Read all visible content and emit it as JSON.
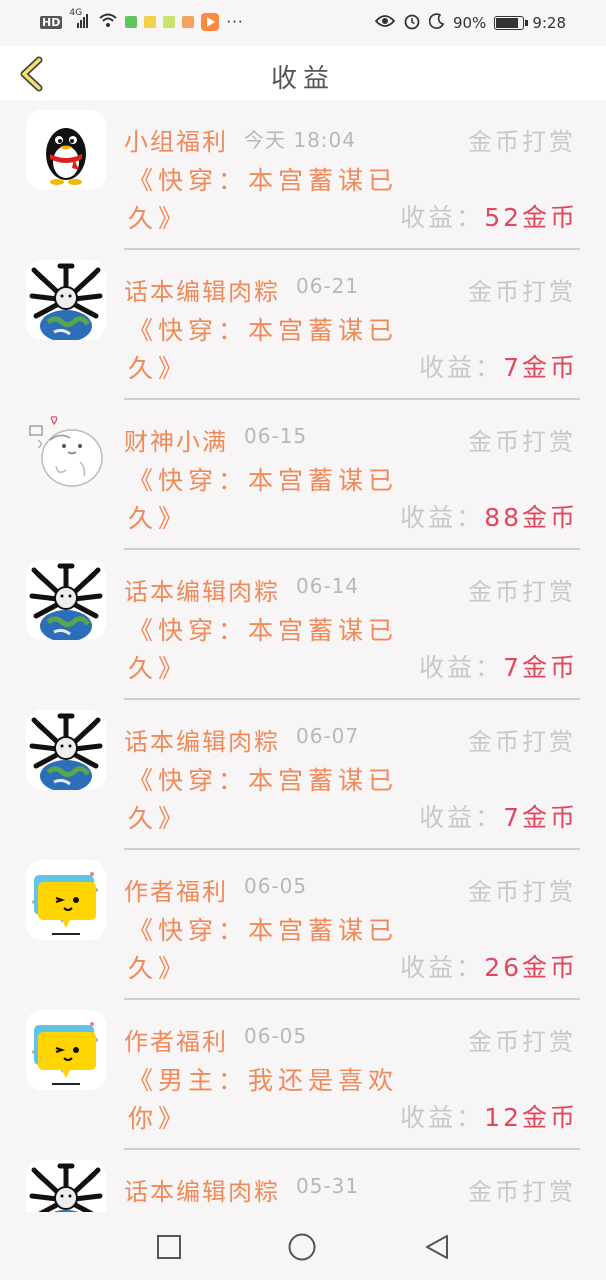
{
  "status_bar": {
    "left_icons": [
      "hd-icon",
      "signal-4g-icon",
      "wifi-icon",
      "app-icon",
      "app-icon",
      "app-icon",
      "app-icon",
      "video-app-icon",
      "more-dots-icon"
    ],
    "hd": "HD",
    "network": "4G",
    "more": "···",
    "battery": "90%",
    "battery_level": 0.9,
    "time": "9:28"
  },
  "header": {
    "title": "收益",
    "back_icon": "chevron-left-icon"
  },
  "items": [
    {
      "avatar": "qq-penguin-avatar",
      "nickname": "小组福利",
      "date": "今天 18:04",
      "reward_type": "金币打赏",
      "book": "《快穿：本宫蓄谋已久》",
      "income_label": "收益：",
      "income_value": "52金币"
    },
    {
      "avatar": "globe-creature-avatar",
      "nickname": "话本编辑肉粽",
      "date": "06-21",
      "reward_type": "金币打赏",
      "book": "《快穿：本宫蓄谋已久》",
      "income_label": "收益：",
      "income_value": "7金币"
    },
    {
      "avatar": "white-creature-avatar",
      "nickname": "财神小满",
      "date": "06-15",
      "reward_type": "金币打赏",
      "book": "《快穿：本宫蓄谋已久》",
      "income_label": "收益：",
      "income_value": "88金币"
    },
    {
      "avatar": "globe-creature-avatar",
      "nickname": "话本编辑肉粽",
      "date": "06-14",
      "reward_type": "金币打赏",
      "book": "《快穿：本宫蓄谋已久》",
      "income_label": "收益：",
      "income_value": "7金币"
    },
    {
      "avatar": "globe-creature-avatar",
      "nickname": "话本编辑肉粽",
      "date": "06-07",
      "reward_type": "金币打赏",
      "book": "《快穿：本宫蓄谋已久》",
      "income_label": "收益：",
      "income_value": "7金币"
    },
    {
      "avatar": "yellow-bubble-avatar",
      "nickname": "作者福利",
      "date": "06-05",
      "reward_type": "金币打赏",
      "book": "《快穿：本宫蓄谋已久》",
      "income_label": "收益：",
      "income_value": "26金币"
    },
    {
      "avatar": "yellow-bubble-avatar",
      "nickname": "作者福利",
      "date": "06-05",
      "reward_type": "金币打赏",
      "book": "《男主：我还是喜欢你》",
      "income_label": "收益：",
      "income_value": "12金币"
    },
    {
      "avatar": "globe-creature-avatar",
      "nickname": "话本编辑肉粽",
      "date": "05-31",
      "reward_type": "金币打赏",
      "book": "",
      "income_label": "",
      "income_value": ""
    }
  ],
  "nav_bar": {
    "buttons": [
      "recent-apps-icon",
      "home-icon",
      "back-triangle-icon"
    ]
  },
  "colors": {
    "background": "#f7f5f6",
    "nickname": "#ef8a5a",
    "muted": "#c8c8c8",
    "income_value": "#e0485e",
    "divider": "#cfcfcf"
  }
}
